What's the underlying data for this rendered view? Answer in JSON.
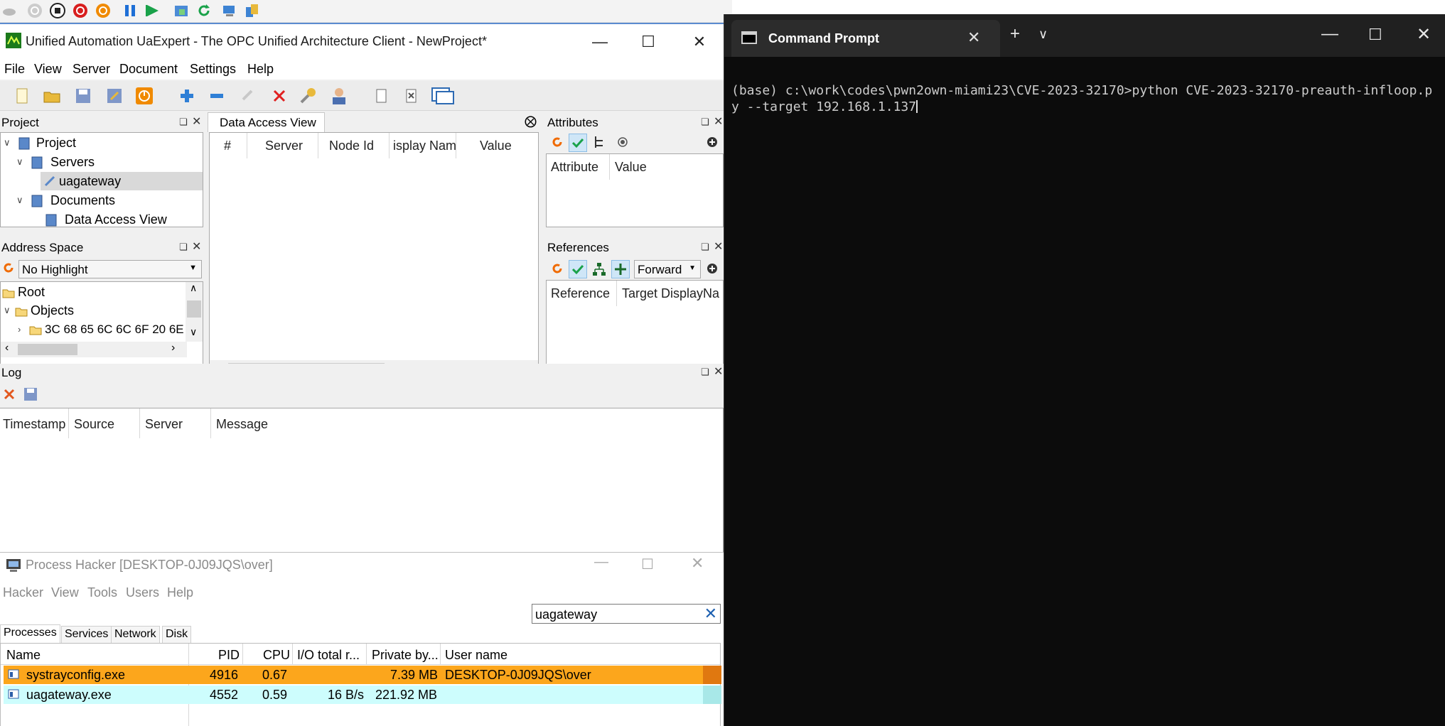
{
  "ua": {
    "title": "Unified Automation UaExpert - The OPC Unified Architecture Client - NewProject*",
    "menu": [
      "File",
      "View",
      "Server",
      "Document",
      "Settings",
      "Help"
    ],
    "project": {
      "header": "Project",
      "items": [
        "Project",
        "Servers",
        "uagateway",
        "Documents",
        "Data Access View"
      ]
    },
    "dav": {
      "tab": "Data Access View",
      "columns": [
        "#",
        "Server",
        "Node Id",
        "isplay Nam",
        "Value"
      ]
    },
    "attributes": {
      "header": "Attributes",
      "columns": [
        "Attribute",
        "Value"
      ]
    },
    "address_space": {
      "header": "Address Space",
      "highlight": "No Highlight",
      "items": [
        "Root",
        "Objects",
        "3C 68 65 6C 6C 6F 20 6E"
      ]
    },
    "references": {
      "header": "References",
      "direction": "Forward",
      "columns": [
        "Reference",
        "Target DisplayNa"
      ]
    },
    "log": {
      "header": "Log",
      "columns": [
        "Timestamp",
        "Source",
        "Server",
        "Message"
      ]
    }
  },
  "ph": {
    "title": "Process Hacker [DESKTOP-0J09JQS\\over]",
    "menu": [
      "Hacker",
      "View",
      "Tools",
      "Users",
      "Help"
    ],
    "search": "uagateway",
    "tabs": [
      "Processes",
      "Services",
      "Network",
      "Disk"
    ],
    "columns": [
      "Name",
      "PID",
      "CPU",
      "I/O total r...",
      "Private by...",
      "User name"
    ],
    "rows": [
      {
        "name": "systrayconfig.exe",
        "pid": "4916",
        "cpu": "0.67",
        "io": "",
        "private": "7.39 MB",
        "user": "DESKTOP-0J09JQS\\over",
        "color": "#fca61c"
      },
      {
        "name": "uagateway.exe",
        "pid": "4552",
        "cpu": "0.59",
        "io": "16 B/s",
        "private": "221.92 MB",
        "user": "",
        "color": "#cdfdfd"
      }
    ]
  },
  "cmd": {
    "tab_title": "Command Prompt",
    "text": "(base) c:\\work\\codes\\pwn2own-miami23\\CVE-2023-32170>python CVE-2023-32170-preauth-infloop.py --target 192.168.1.137"
  },
  "colors": {
    "accent": "#5b8bd0",
    "ph_row_1": "#fca61c",
    "ph_row_2": "#cdfdfd",
    "cmd_bg": "#0c0c0c"
  }
}
